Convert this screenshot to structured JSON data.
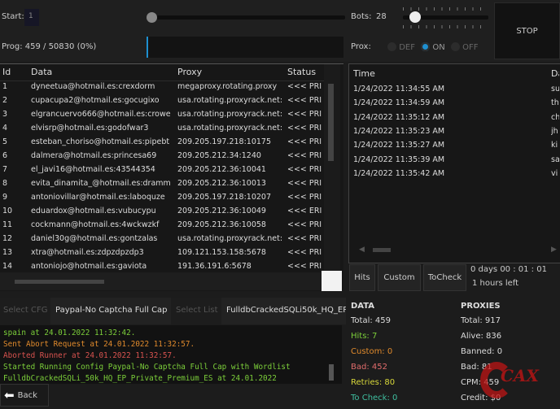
{
  "top": {
    "start_label": "Start:",
    "start_value": "1",
    "prog_label": "Prog: 459 / 50830 (0%)",
    "bots_label": "Bots:",
    "bots_value": "28",
    "prox_label": "Prox:",
    "prox_options": [
      "DEF",
      "ON",
      "OFF"
    ],
    "prox_selected": "ON",
    "stop_label": "STOP",
    "progress": 0.009
  },
  "data_table": {
    "columns": [
      "Id",
      "Data",
      "Proxy",
      "Status"
    ],
    "rows": [
      [
        "1",
        "dyneetua@hotmail.es:crexdorm",
        "megaproxy.rotating.proxy",
        "<<< PRI"
      ],
      [
        "2",
        "cupacupa2@hotmail.es:gocugixo",
        "usa.rotating.proxyrack.net:",
        "<<< PRI"
      ],
      [
        "3",
        "elgrancuervo666@hotmail.es:crowe",
        "usa.rotating.proxyrack.net:",
        "<<< PRI"
      ],
      [
        "4",
        "elvisrp@hotmail.es:godofwar3",
        "usa.rotating.proxyrack.net:",
        "<<< PRI"
      ],
      [
        "5",
        "esteban_choriso@hotmail.es:pipebt",
        "209.205.197.218:10175",
        "<<< PRI"
      ],
      [
        "6",
        "dalmera@hotmail.es:princesa69",
        "209.205.212.34:1240",
        "<<< PRI"
      ],
      [
        "7",
        "el_javi16@hotmail.es:43544354",
        "209.205.212.36:10041",
        "<<< PRI"
      ],
      [
        "8",
        "evita_dinamita_@hotmail.es:dramm",
        "209.205.212.36:10013",
        "<<< PRI"
      ],
      [
        "9",
        "antoniovillar@hotmail.es:laboquze",
        "209.205.197.218:10207",
        "<<< PRI"
      ],
      [
        "10",
        "eduardox@hotmail.es:vubucypu",
        "209.205.212.36:10049",
        "<<< ERI"
      ],
      [
        "11",
        "cockmann@hotmail.es:4wckwzkf",
        "209.205.212.36:10058",
        "<<< PRI"
      ],
      [
        "12",
        "daniel30g@hotmail.es:gontzalas",
        "usa.rotating.proxyrack.net:",
        "<<< PRI"
      ],
      [
        "13",
        "xtra@hotmail.es:zdpzdpzdp3",
        "109.121.153.158:5678",
        "<<< PRI"
      ],
      [
        "14",
        "antoniojo@hotmail.es:gaviota",
        "191.36.191.6:5678",
        "<<< PRI"
      ]
    ]
  },
  "hits_table": {
    "columns": [
      "Time",
      "Da"
    ],
    "rows": [
      [
        "1/24/2022 11:34:55 AM",
        "su"
      ],
      [
        "1/24/2022 11:34:59 AM",
        "th"
      ],
      [
        "1/24/2022 11:35:12 AM",
        "ch"
      ],
      [
        "1/24/2022 11:35:23 AM",
        "jh"
      ],
      [
        "1/24/2022 11:35:27 AM",
        "ki"
      ],
      [
        "1/24/2022 11:35:39 AM",
        "sa"
      ],
      [
        "1/24/2022 11:35:42 AM",
        "vi"
      ]
    ]
  },
  "hit_buttons": [
    "Hits",
    "Custom",
    "ToCheck"
  ],
  "timer": {
    "elapsed": "0  days  00 : 01 : 01",
    "left": "1 hours left"
  },
  "config": {
    "select_cfg": "Select CFG",
    "cfg_name": "Paypal-No Captcha Full Cap",
    "select_list": "Select List",
    "list_name": "FulldbCrackedSQLi50k_HQ_EP_"
  },
  "log": [
    {
      "text": "spain at 24.01.2022 11:32:42.",
      "color": "#7ccf3a"
    },
    {
      "text": "Sent Abort Request at 24.01.2022 11:32:57.",
      "color": "#e08a2c"
    },
    {
      "text": "Aborted Runner at 24.01.2022 11:32:57.",
      "color": "#d9534f"
    },
    {
      "text": "Started Running Config Paypal-No Captcha Full Cap with Wordlist",
      "color": "#7ccf3a"
    },
    {
      "text": "FulldbCrackedSQLi_50k_HQ_EP_Private_Premium_ES at 24.01.2022",
      "color": "#7ccf3a"
    }
  ],
  "back_label": "Back",
  "data_stats": {
    "title": "DATA",
    "items": [
      {
        "label": "Total:  459",
        "color": "#dddddd"
      },
      {
        "label": "Hits:  7",
        "color": "#7ccf3a"
      },
      {
        "label": "Custom:  0",
        "color": "#e08a2c"
      },
      {
        "label": "Bad:  452",
        "color": "#e06c6c"
      },
      {
        "label": "Retries:  80",
        "color": "#d8d83a"
      },
      {
        "label": "To Check:  0",
        "color": "#3fbfa0"
      }
    ]
  },
  "proxy_stats": {
    "title": "PROXIES",
    "items": [
      {
        "label": "Total:  917",
        "color": "#dddddd"
      },
      {
        "label": "Alive:  836",
        "color": "#dddddd"
      },
      {
        "label": "Banned:  0",
        "color": "#dddddd"
      },
      {
        "label": "Bad:  81",
        "color": "#dddddd"
      },
      {
        "label": "CPM:  459",
        "color": "#dddddd"
      },
      {
        "label": "Credit:  $0",
        "color": "#dddddd"
      }
    ]
  },
  "watermark": "CAX",
  "accent": "#1e8fd0"
}
